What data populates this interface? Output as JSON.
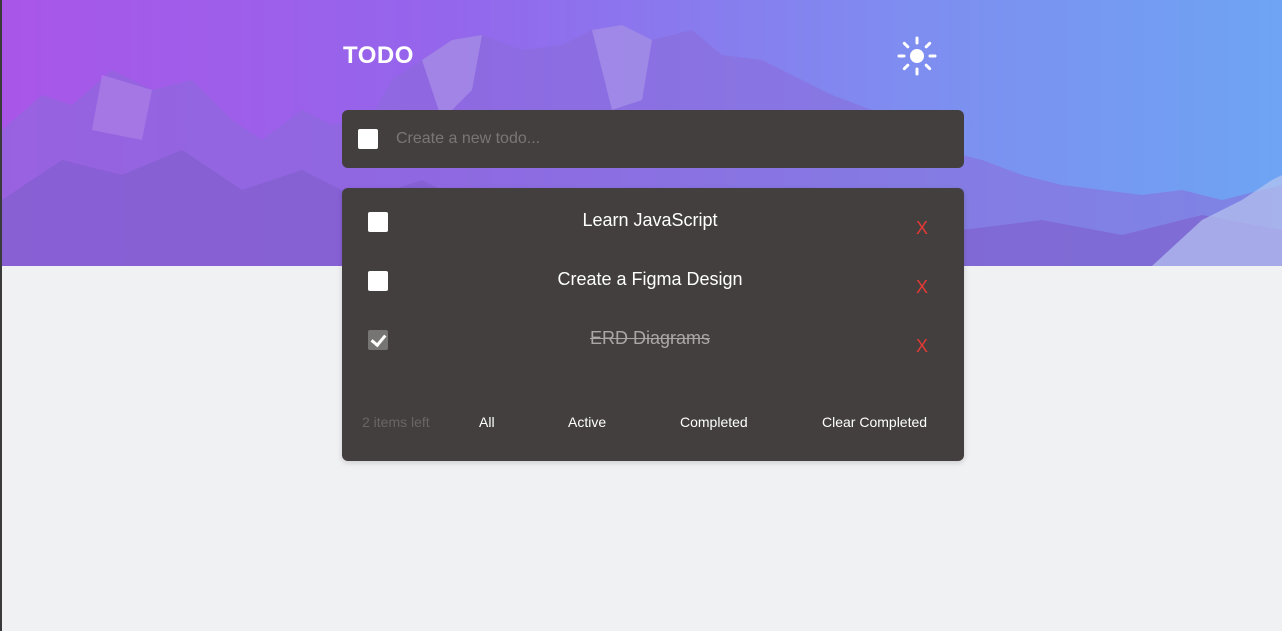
{
  "header": {
    "title": "TODO",
    "theme_icon": "sun-icon"
  },
  "new_todo": {
    "placeholder": "Create a new todo...",
    "value": ""
  },
  "todos": [
    {
      "text": "Learn JavaScript",
      "completed": false,
      "delete_label": "X"
    },
    {
      "text": "Create a Figma Design",
      "completed": false,
      "delete_label": "X"
    },
    {
      "text": "ERD Diagrams",
      "completed": true,
      "delete_label": "X"
    }
  ],
  "footer": {
    "items_left": "2 items left",
    "filters": [
      "All",
      "Active",
      "Completed"
    ],
    "clear_label": "Clear Completed"
  },
  "colors": {
    "gradient_start": "#a956e8",
    "gradient_end": "#6ea4f3",
    "card": "#433f3e",
    "delete": "#e53935",
    "page_bg": "#f0f1f3"
  }
}
